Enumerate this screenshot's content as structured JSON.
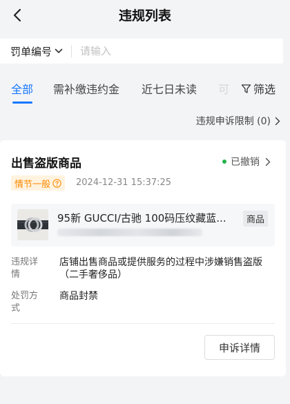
{
  "nav": {
    "title": "违规列表"
  },
  "search": {
    "type_label": "罚单编号",
    "placeholder": "请输入"
  },
  "tabs": [
    {
      "label": "全部"
    },
    {
      "label": "需补缴违约金"
    },
    {
      "label": "近七日未读"
    },
    {
      "label": "可"
    }
  ],
  "filter": {
    "label": "筛选"
  },
  "appeal_limit": {
    "label": "违规申诉限制 (0)"
  },
  "card": {
    "title": "出售盗版商品",
    "status": "已撤销",
    "severity_tag": "情节一般",
    "time": "2024-12-31 15:37:25",
    "goods": {
      "name": "95新 GUCCI/古驰 100码压纹藏蓝...",
      "badge": "商品"
    },
    "violation_label": "违规详情",
    "violation_value": "店铺出售商品或提供服务的过程中涉嫌销售盗版（二手奢侈品）",
    "penalty_label": "处罚方式",
    "penalty_value": "商品封禁",
    "appeal_button": "申诉详情"
  },
  "colors": {
    "accent": "#1677ff",
    "status_dot": "#22b34a",
    "tag_text": "#ff8a00",
    "tag_bg": "#fff3e0"
  }
}
